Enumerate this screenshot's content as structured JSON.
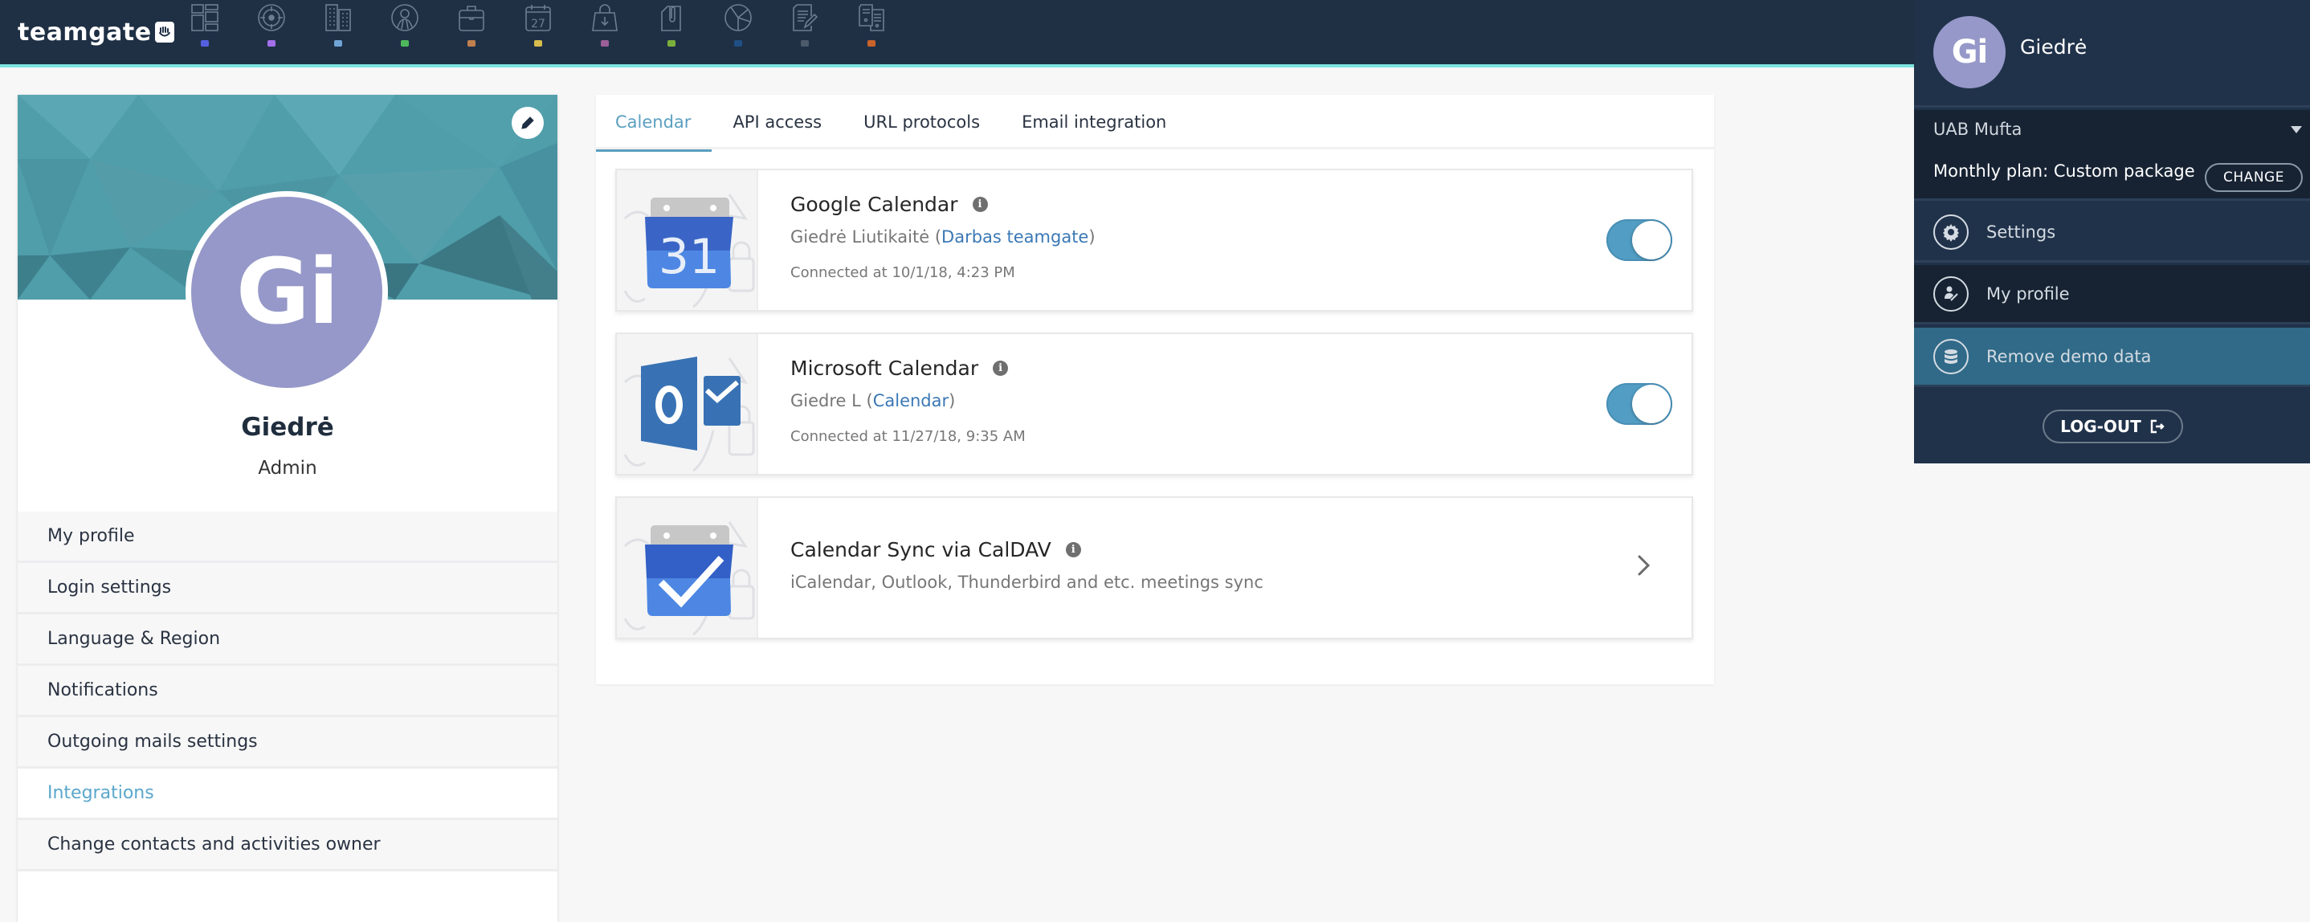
{
  "app": {
    "logo_text": "teamgate",
    "accent_color": "#5aa0c0",
    "nav_line_color": "#7de3e1"
  },
  "topnav": {
    "items": [
      {
        "icon": "dashboard-icon",
        "label": "Dashboard",
        "color": "#5560e0"
      },
      {
        "icon": "target-icon",
        "label": "Leads",
        "color": "#a470ea"
      },
      {
        "icon": "buildings-icon",
        "label": "Companies",
        "color": "#6fa4d6"
      },
      {
        "icon": "person-icon",
        "label": "People",
        "color": "#4fb85c"
      },
      {
        "icon": "briefcase-icon",
        "label": "Deals",
        "color": "#c07f4e"
      },
      {
        "icon": "calendar-icon",
        "label": "Calendar",
        "color": "#d9bd4c",
        "icon_text": "27"
      },
      {
        "icon": "shopping-bag-icon",
        "label": "Sales",
        "color": "#9b5f98"
      },
      {
        "icon": "paperclip-file-icon",
        "label": "Documents",
        "color": "#7cae3c"
      },
      {
        "icon": "pie-chart-icon",
        "label": "Reports",
        "color": "#1f4f85"
      },
      {
        "icon": "note-edit-icon",
        "label": "Notes",
        "color": "#4c5a69"
      },
      {
        "icon": "invoices-icon",
        "label": "Invoices",
        "color": "#c9632a"
      }
    ]
  },
  "profile": {
    "initials": "Gi",
    "name": "Giedrė",
    "role": "Admin",
    "avatar_color": "#9598c8",
    "menu": [
      {
        "label": "My profile",
        "active": false
      },
      {
        "label": "Login settings",
        "active": false
      },
      {
        "label": "Language & Region",
        "active": false
      },
      {
        "label": "Notifications",
        "active": false
      },
      {
        "label": "Outgoing mails settings",
        "active": false
      },
      {
        "label": "Integrations",
        "active": true
      },
      {
        "label": "Change contacts and activities owner",
        "active": false
      }
    ]
  },
  "tabs": [
    {
      "label": "Calendar",
      "active": true
    },
    {
      "label": "API access",
      "active": false
    },
    {
      "label": "URL protocols",
      "active": false
    },
    {
      "label": "Email integration",
      "active": false
    }
  ],
  "integrations": [
    {
      "title": "Google Calendar",
      "icon": "google-calendar-icon",
      "icon_text": "31",
      "account_name": "Giedrė Liutikaitė",
      "account_link": "Darbas teamgate",
      "connected": "Connected at 10/1/18, 4:23 PM",
      "enabled": true
    },
    {
      "title": "Microsoft Calendar",
      "icon": "outlook-icon",
      "icon_text": "O",
      "account_name": "Giedre L",
      "account_link": "Calendar",
      "connected": "Connected at 11/27/18, 9:35 AM",
      "enabled": true
    },
    {
      "title": "Calendar Sync via CalDAV",
      "icon": "caldav-calendar-check-icon",
      "description": "iCalendar, Outlook, Thunderbird and etc. meetings sync"
    }
  ],
  "user_panel": {
    "initials": "Gi",
    "name": "Giedrė",
    "company": "UAB Mufta",
    "plan": "Monthly plan: Custom package",
    "change_label": "CHANGE",
    "items": [
      {
        "label": "Settings",
        "icon": "gear-icon"
      },
      {
        "label": "My profile",
        "icon": "profile-edit-icon"
      },
      {
        "label": "Remove demo data",
        "icon": "database-icon"
      }
    ],
    "logout_label": "LOG-OUT"
  }
}
